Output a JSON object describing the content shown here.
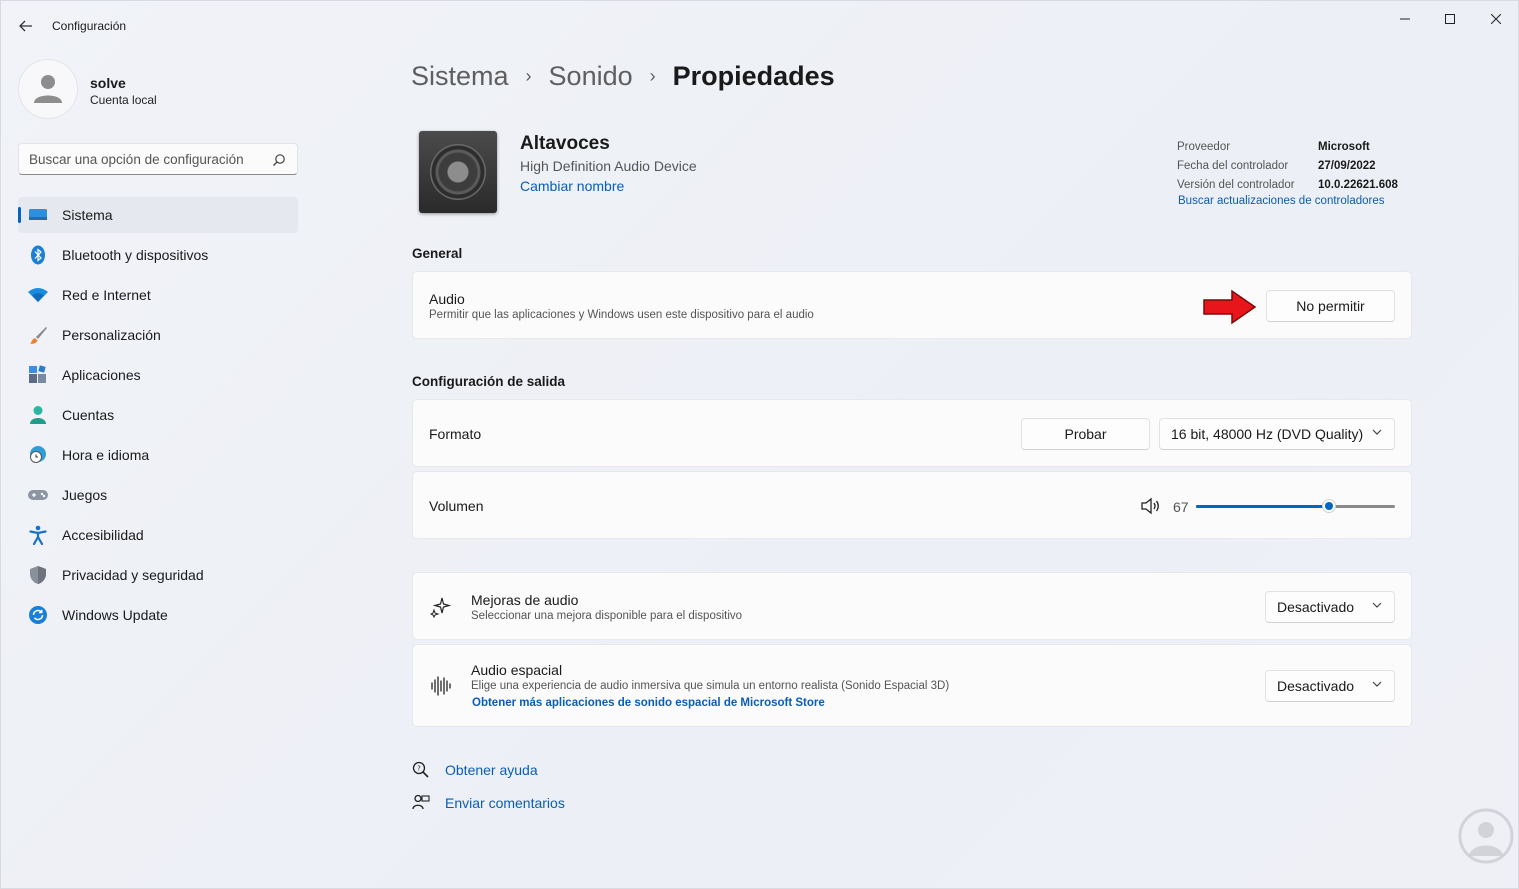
{
  "window": {
    "title": "Configuración"
  },
  "profile": {
    "name": "solve",
    "account_type": "Cuenta local"
  },
  "search": {
    "placeholder": "Buscar una opción de configuración"
  },
  "sidebar": {
    "items": [
      {
        "label": "Sistema",
        "icon": "monitor-icon",
        "active": true
      },
      {
        "label": "Bluetooth y dispositivos",
        "icon": "bluetooth-icon"
      },
      {
        "label": "Red e Internet",
        "icon": "wifi-icon"
      },
      {
        "label": "Personalización",
        "icon": "brush-icon"
      },
      {
        "label": "Aplicaciones",
        "icon": "apps-icon"
      },
      {
        "label": "Cuentas",
        "icon": "person-icon"
      },
      {
        "label": "Hora e idioma",
        "icon": "globe-clock-icon"
      },
      {
        "label": "Juegos",
        "icon": "gamepad-icon"
      },
      {
        "label": "Accesibilidad",
        "icon": "accessibility-icon"
      },
      {
        "label": "Privacidad y seguridad",
        "icon": "shield-icon"
      },
      {
        "label": "Windows Update",
        "icon": "update-icon"
      }
    ]
  },
  "breadcrumb": {
    "items": [
      "Sistema",
      "Sonido"
    ],
    "current": "Propiedades"
  },
  "device": {
    "name": "Altavoces",
    "description": "High Definition Audio Device",
    "rename_label": "Cambiar nombre"
  },
  "driver_info": {
    "rows": [
      {
        "key": "Proveedor",
        "value": "Microsoft"
      },
      {
        "key": "Fecha del controlador",
        "value": "27/09/2022"
      },
      {
        "key": "Versión del controlador",
        "value": "10.0.22621.608"
      }
    ],
    "update_link": "Buscar actualizaciones de controladores"
  },
  "general": {
    "title": "General",
    "audio": {
      "title": "Audio",
      "description": "Permitir que las aplicaciones y Windows usen este dispositivo para el audio",
      "button_label": "No permitir"
    }
  },
  "output": {
    "title": "Configuración de salida",
    "format": {
      "title": "Formato",
      "test_label": "Probar",
      "selected": "16 bit, 48000 Hz (DVD Quality)"
    },
    "volume": {
      "title": "Volumen",
      "value": "67",
      "fraction": 0.67
    }
  },
  "enhancements": {
    "title": "Mejoras de audio",
    "description": "Seleccionar una mejora disponible para el dispositivo",
    "selected": "Desactivado"
  },
  "spatial": {
    "title": "Audio espacial",
    "description": "Elige una experiencia de audio inmersiva que simula un entorno realista (Sonido Espacial 3D)",
    "link": "Obtener más aplicaciones de sonido espacial de Microsoft Store",
    "selected": "Desactivado"
  },
  "footer": {
    "help": "Obtener ayuda",
    "feedback": "Enviar comentarios"
  },
  "colors": {
    "accent": "#0067c0",
    "link": "#0a5db3",
    "arrow": "#e8161b"
  }
}
